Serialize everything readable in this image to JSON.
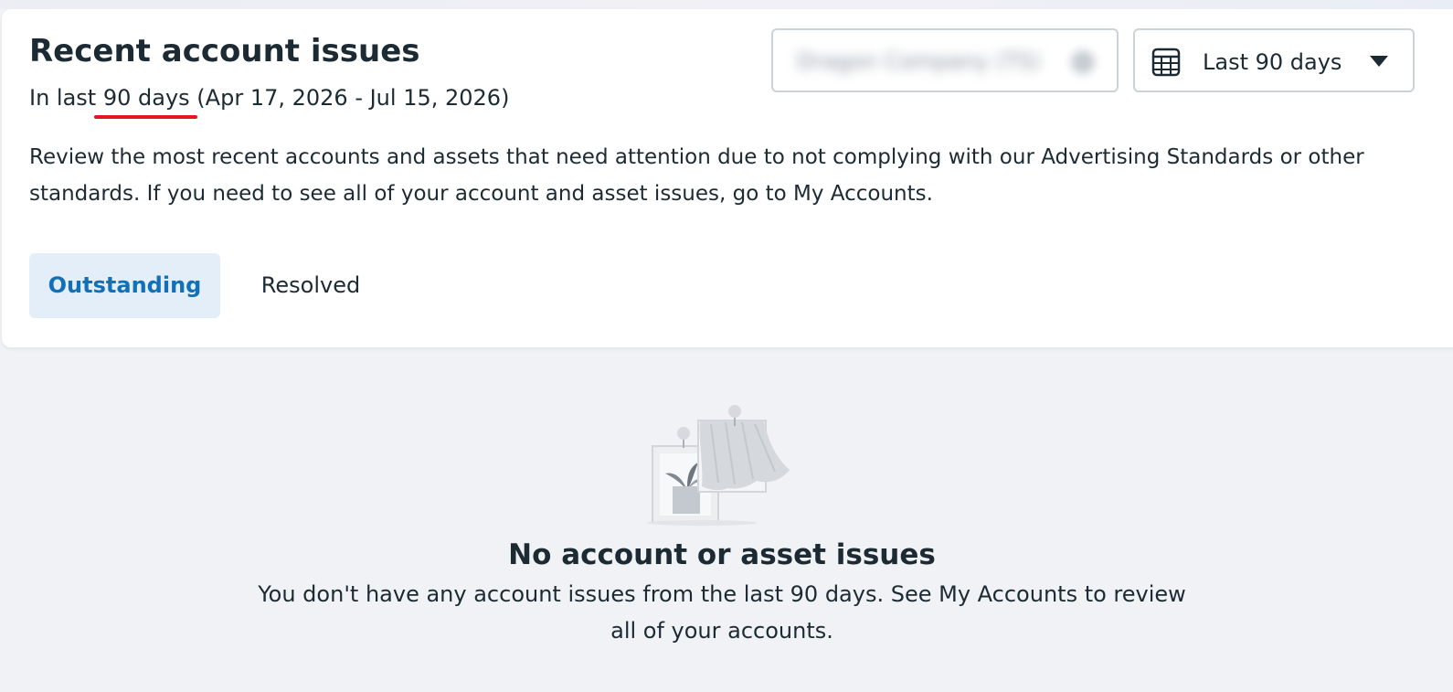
{
  "header": {
    "title": "Recent account issues",
    "subtitle_prefix": "In last ",
    "subtitle_highlight": "90 days",
    "subtitle_suffix": " (Apr 17, 2026 - Jul 15, 2026)",
    "description": "Review the most recent accounts and assets that need attention due to not complying with our Advertising Standards or other standards. If you need to see all of your account and asset issues, go to My Accounts."
  },
  "company_select": {
    "value": "Dragon Company (TS)",
    "state": "blurred"
  },
  "date_select": {
    "icon": "calendar-icon",
    "label": "Last 90 days",
    "dropdown_icon": "caret-down-icon"
  },
  "tabs": [
    {
      "label": "Outstanding",
      "active": true
    },
    {
      "label": "Resolved",
      "active": false
    }
  ],
  "empty_state": {
    "illustration": "empty-window-illustration",
    "title": "No account or asset issues",
    "text": "You don't have any account issues from the last 90 days. See My Accounts to review all of your accounts."
  },
  "colors": {
    "accent": "#1170b8",
    "active_tab_bg": "#e4eef8",
    "highlight_underline": "#e4161f",
    "text": "#1c2b33"
  }
}
